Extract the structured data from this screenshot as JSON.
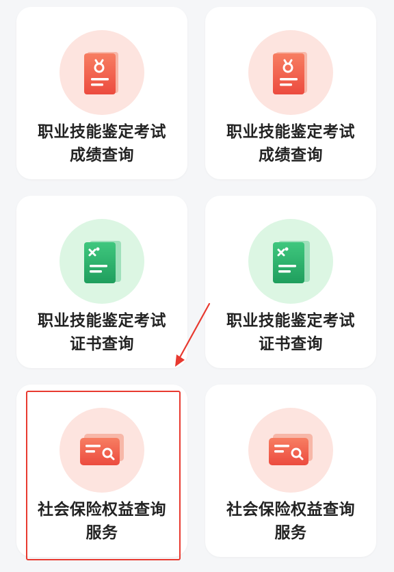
{
  "colors": {
    "red_circle_bg": "#fde4df",
    "red_icon": "#f2584a",
    "green_circle_bg": "#dcf6e3",
    "green_icon": "#2cb36c",
    "highlight": "#e8392f",
    "card_bg": "#ffffff",
    "text": "#222222"
  },
  "cards": [
    {
      "icon": "certificate-medal-icon",
      "line1": "职业技能鉴定考试",
      "line2": "成绩查询"
    },
    {
      "icon": "certificate-medal-icon",
      "line1": "职业技能鉴定考试",
      "line2": "成绩查询"
    },
    {
      "icon": "certificate-check-icon",
      "line1": "职业技能鉴定考试",
      "line2": "证书查询"
    },
    {
      "icon": "certificate-check-icon",
      "line1": "职业技能鉴定考试",
      "line2": "证书查询"
    },
    {
      "icon": "card-search-icon",
      "line1": "社会保险权益查询",
      "line2": "服务"
    },
    {
      "icon": "card-search-icon",
      "line1": "社会保险权益查询",
      "line2": "服务"
    }
  ],
  "annotations": {
    "highlight_target": "card-social-insurance-left",
    "arrow_icon": "annotation-arrow-icon"
  }
}
